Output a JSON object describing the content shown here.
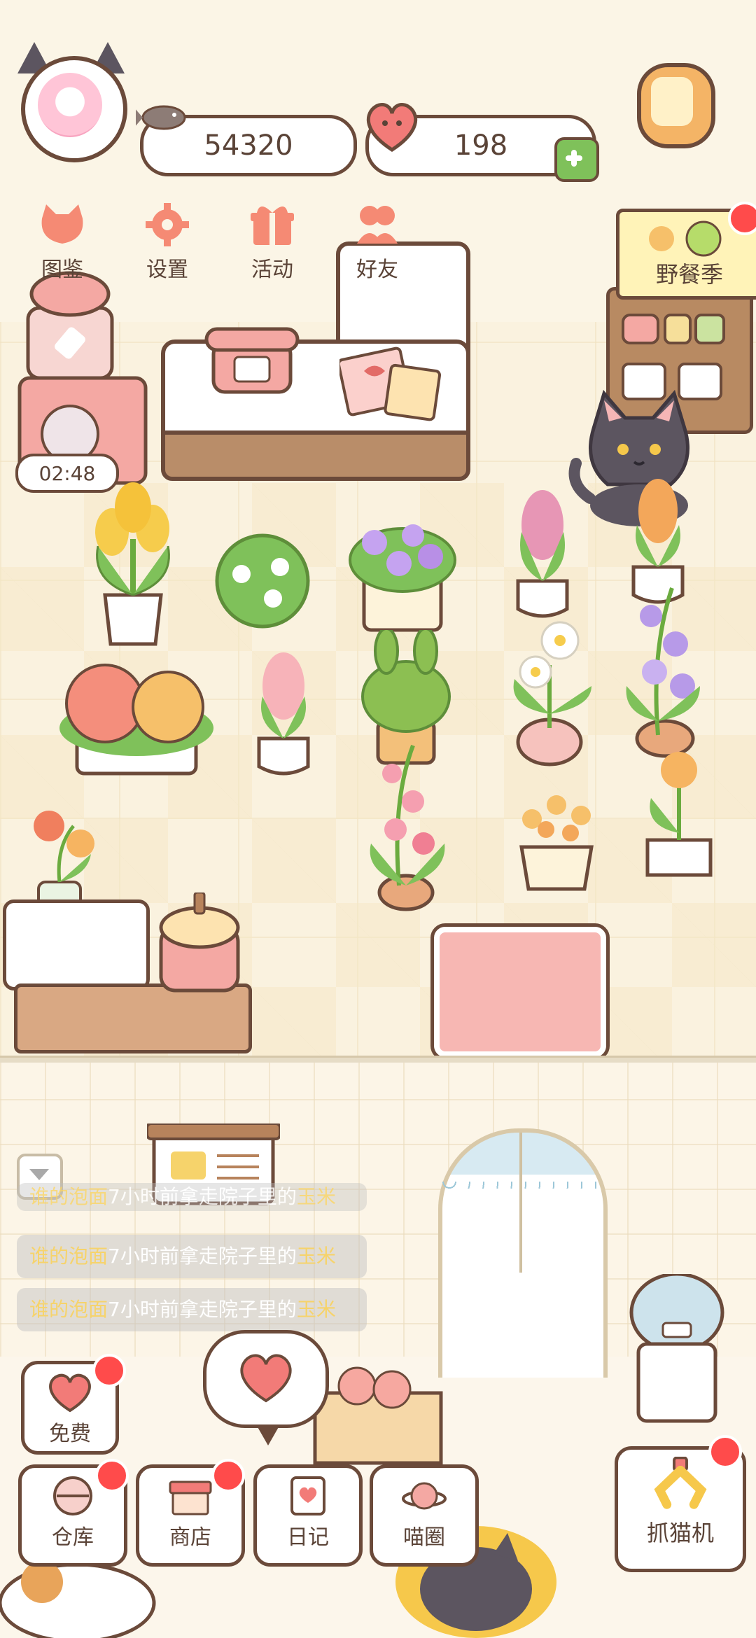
{
  "hud": {
    "coins": "54320",
    "hearts": "198"
  },
  "menu": [
    {
      "label": "图鉴",
      "icon": "cat-face-icon"
    },
    {
      "label": "设置",
      "icon": "gear-icon"
    },
    {
      "label": "活动",
      "icon": "gift-icon"
    },
    {
      "label": "好友",
      "icon": "friends-icon"
    }
  ],
  "event": {
    "label": "野餐季"
  },
  "timer": "02:48",
  "chat": {
    "lines": [
      {
        "who": "谁的泡面",
        "mid": "7小时前拿走院子里的",
        "item": "玉米"
      },
      {
        "who": "谁的泡面",
        "mid": "7小时前拿走院子里的",
        "item": "玉米"
      },
      {
        "who": "谁的泡面",
        "mid": "7小时前拿走院子里的",
        "item": "玉米"
      }
    ]
  },
  "buttons": {
    "free": "免费",
    "warehouse": "仓库",
    "shop": "商店",
    "diary": "日记",
    "circle": "喵圈",
    "grab_cat": "抓猫机"
  },
  "colors": {
    "accent_pink": "#f07f79",
    "plus_green": "#7fc15a",
    "badge_red": "#ff4b4b",
    "outline": "#6b4a3a"
  }
}
